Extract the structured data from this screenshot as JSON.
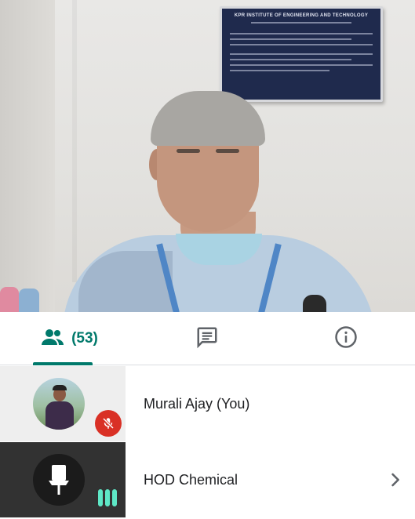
{
  "video": {
    "notice_title": "KPR INSTITUTE OF ENGINEERING AND TECHNOLOGY"
  },
  "tabs": [
    {
      "id": "people",
      "icon": "people-icon",
      "count_label": "(53)",
      "active": true
    },
    {
      "id": "chat",
      "icon": "chat-icon",
      "active": false
    },
    {
      "id": "info",
      "icon": "info-icon",
      "active": false
    }
  ],
  "colors": {
    "accent": "#00796b",
    "mute_red": "#d93025",
    "speaking_green": "#5ee7c6",
    "text": "#202124"
  },
  "participants": [
    {
      "name": "Murali Ajay (You)",
      "avatar": "photo",
      "status_icon": "mic-off-icon",
      "muted": true
    },
    {
      "name": "HOD Chemical",
      "avatar": "pin-icon",
      "status_icon": "speaking-bars-icon",
      "muted": false,
      "has_chevron": true
    }
  ]
}
